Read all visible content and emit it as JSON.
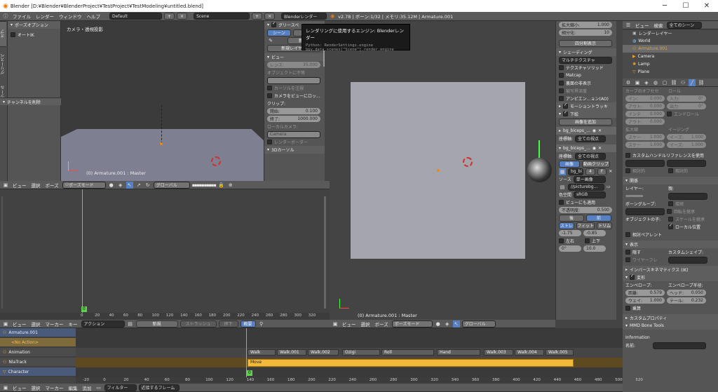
{
  "window": {
    "title": "Blender [D:¥Blender¥BlenderProject¥TestProject¥TestModeling¥untitled.blend]",
    "minimize": "─",
    "maximize": "☐",
    "close": "✕"
  },
  "infobar": {
    "menus": [
      "ファイル",
      "レンダー",
      "ウィンドウ",
      "ヘルプ"
    ],
    "layout": "Default",
    "scene": "Scene",
    "engine": "Blenderレンダー",
    "stats": "v2.78 | ボーン:1/32 | メモリ:35.12M | Armature.001"
  },
  "tooltip": {
    "title": "レンダリングに使用するエンジン:",
    "value": "Blenderレンダー",
    "line1": "Python: RenderSettings.engine",
    "line2": "bpy.data.scenes[\"Scene\"].render.engine"
  },
  "toolshelf": {
    "title": "ポーズオプション",
    "autoik": "オートIK",
    "tabs": [
      "オプ",
      "グリースペ",
      "ツール"
    ],
    "redo": "チャンネルを削除"
  },
  "vp1": {
    "label": "カメラ・透視投影",
    "info": "(0) Armature.001 : Master"
  },
  "props_panel": {
    "grease_title": "グリースペ",
    "scene_tab": "シーン",
    "obj_tab": "オブ",
    "new_btn": "新規",
    "new_layer": "新規レイヤー",
    "view_title": "ビュー",
    "lens": "レンズ:",
    "lens_val": "35.000",
    "lock_obj": "オブジェクトに不等",
    "lock_cursor": "カーソルを注視",
    "cam_to_view": "カメラをビューにロッ...",
    "clip": "クリップ:",
    "start": "開始:",
    "start_val": "0.100",
    "end": "終了:",
    "end_val": "1000.000",
    "local_cam": "ローカルカメラ:",
    "camera": "Camera",
    "render_border": "レンダーボーダー",
    "cursor3d": "3Dカーソル"
  },
  "vp1hdr": {
    "items": [
      "ビュー",
      "選択",
      "ポーズ"
    ],
    "mode": "ポーズモード",
    "orient": "グローバル"
  },
  "vp2": {
    "info": "(0) Armature.001 : Master"
  },
  "vp2hdr": {
    "items": [
      "ビュー",
      "選択",
      "ポーズ"
    ],
    "mode": "ポーズモード",
    "orient": "グローバル"
  },
  "npanel": {
    "zoom": "拡大縮小:",
    "zoom_val": "1.000",
    "sub": "細分化:",
    "sub_val": "10",
    "quad": "四分割表示",
    "shading": "シェーディング",
    "matcap_mode": "マルチテクスチャ",
    "tex_solid": "テクスチャソリッド",
    "matcap": "Matcap",
    "backface": "裏面の非表示",
    "depth": "被写界深度",
    "ao": "アンビエン...ョン(AO)",
    "motion": "モーショントラッキ",
    "bg": "下絵",
    "add_image": "画像を追加",
    "bg1": "bg_biceps_...",
    "axis": "座標軸:",
    "all_views": "全ての視点",
    "bg2": "bg_biceps_...",
    "image": "画像",
    "movie": "動画クリップ",
    "bgfile": "bg_bi",
    "bg_num": "4",
    "bg_f": "F",
    "source": "ソース",
    "single": "単一画像",
    "path": "//picturebg...",
    "colorspace": "色空間",
    "srgb": "sRGB",
    "view_as_render": "ビューにも適用",
    "opacity": "不透明度:",
    "opacity_val": "0.500",
    "back": "後",
    "front": "前",
    "stretch": "ストレ",
    "fit": "フィット",
    "crop": "トリム",
    "x": "-1.75",
    "y": "-0.85",
    "flip_x": "左右",
    "flip_y": "上下",
    "rot": "0°",
    "size": "10.0"
  },
  "outliner": {
    "view": "ビュー",
    "search": "検索",
    "all_scenes": "全てのシーン",
    "render_layer": "レンダーレイヤー",
    "world": "World",
    "armature": "Armature.001",
    "camera": "Camera",
    "lamp": "Lamp",
    "plane": "Plane"
  },
  "bone": {
    "lbl_a": "カーブのオフセセ",
    "lbl_roll": "ロール",
    "in": "イン:",
    "in_val": "0.000",
    "out": "アウト:",
    "out_val": "0.000",
    "out2": "アウト:",
    "in2": "インテ",
    "in_r": "入力:",
    "in_r_val": "0°",
    "out_r": "出力:",
    "out_r_val": "0°",
    "endroll": "エンドロール",
    "scale": "拡大縮",
    "ease": "イージング",
    "scale_in": "スケー",
    "scale_in_val": "1.000",
    "ease_in": "イーズ:",
    "ease_in_val": "1.000",
    "scale_out": "スケー",
    "scale_out_val": "1.000",
    "ease_out": "イーズ:",
    "ease_out_val": "1.000",
    "custom_handle": "カスタムハンドルリファレンスを使用",
    "rel_prev": "相対的",
    "rel_next": "相対的",
    "relations": "関係",
    "layer": "レイヤー:",
    "parent": "親:",
    "bone_group": "ボーングループ:",
    "obj_children": "オブジェクトの子:",
    "connect": "接続",
    "inherit_rot": "回転を継承",
    "inherit_scale": "スケールを継承",
    "local_loc": "ローカル位置",
    "rel_parent": "相対ペアレント",
    "display": "表示",
    "hide": "隠す",
    "wire": "ワイヤーフレ",
    "custom_shape": "カスタムシェイプ:",
    "ik": "インバースキネマティクス (IK)",
    "deform": "変形",
    "envelope": "エンベロープ:",
    "envelope_mult": "エンベロープ半径:",
    "dist": "距離:",
    "dist_val": "0.579",
    "head": "ヘッド:",
    "head_val": "0.050",
    "weight": "ウェイ:",
    "weight_val": "1.000",
    "tail": "テール:",
    "tail_val": "0.232",
    "multiply": "乗算",
    "custom_props": "カスタムプロパティ",
    "mmd": "MMD Bone Tools",
    "information": "Information",
    "name": "名前:"
  },
  "ruler1": {
    "ticks": [
      "0",
      "20",
      "40",
      "60",
      "80",
      "100",
      "120",
      "140",
      "160",
      "180",
      "200",
      "220",
      "240",
      "260",
      "280",
      "300",
      "320"
    ],
    "frame": "0"
  },
  "nlahdr": {
    "items": [
      "ビュー",
      "選択",
      "マーカー",
      "キー"
    ],
    "action": "アクション",
    "new": "新規",
    "stash": "ストラッシュ",
    "push": "押下",
    "summary": "概要"
  },
  "nlatracks": {
    "armature": "Armature.001",
    "no_action": "<No Action>",
    "animation": "Animation",
    "nla": "NlaTrack",
    "character": "Character"
  },
  "strips": {
    "walk": "Walk",
    "walk1": "Walk.001",
    "walk2": "Walk.002",
    "ozigi": "Ozigi",
    "roll": "Roll",
    "hand": "Hand",
    "walk3": "Walk.003",
    "walk4": "Walk.004",
    "walk5": "Walk.005",
    "move": "Move"
  },
  "ruler2": {
    "ticks": [
      "-20",
      "0",
      "20",
      "40",
      "60",
      "80",
      "100",
      "120",
      "140",
      "160",
      "180",
      "200",
      "220",
      "240",
      "260",
      "280",
      "300",
      "320",
      "340",
      "360",
      "380",
      "400",
      "420",
      "440",
      "460",
      "480",
      "500",
      "520"
    ],
    "frame": "0"
  },
  "bottomhdr": {
    "items": [
      "ビュー",
      "選択",
      "マーカー",
      "編集",
      "追加"
    ],
    "filter": "フィルター",
    "near": "近接するフレーム"
  },
  "colors": {
    "accent": "#5680c2",
    "strip": "#f2b93b",
    "selected": "#f0a020"
  }
}
